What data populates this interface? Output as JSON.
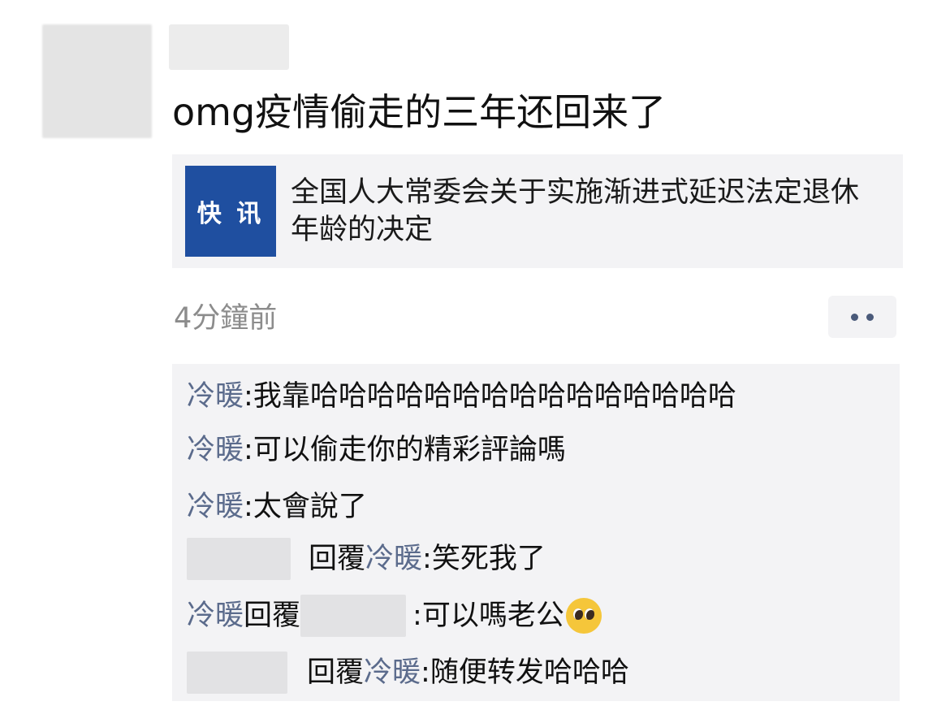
{
  "post": {
    "text": "omg疫情偷走的三年还回来了"
  },
  "share_card": {
    "thumb_label": "快 讯",
    "title": "全国人大常委会关于实施渐进式延迟法定退休年龄的决定"
  },
  "meta": {
    "time": "4分鐘前"
  },
  "comments": [
    {
      "name": "冷暖",
      "sep": ": ",
      "text": "我靠哈哈哈哈哈哈哈哈哈哈哈哈哈哈哈"
    },
    {
      "name": "冷暖",
      "sep": ": ",
      "text": "可以偷走你的精彩評論嗎"
    },
    {
      "name": "冷暖",
      "sep": ": ",
      "text": "太會說了"
    },
    {
      "reply_word": "回覆",
      "target": "冷暖",
      "sep": ": ",
      "text": "笑死我了"
    },
    {
      "name": "冷暖",
      "reply_word": "回覆",
      "sep": ": ",
      "text": "可以嗎老公"
    },
    {
      "reply_word": "回覆",
      "target": "冷暖",
      "sep": ": ",
      "text": "随便转发哈哈哈"
    }
  ],
  "icons": {
    "more": "more-dots-icon",
    "emoji": "pleading-face-emoji-icon"
  }
}
